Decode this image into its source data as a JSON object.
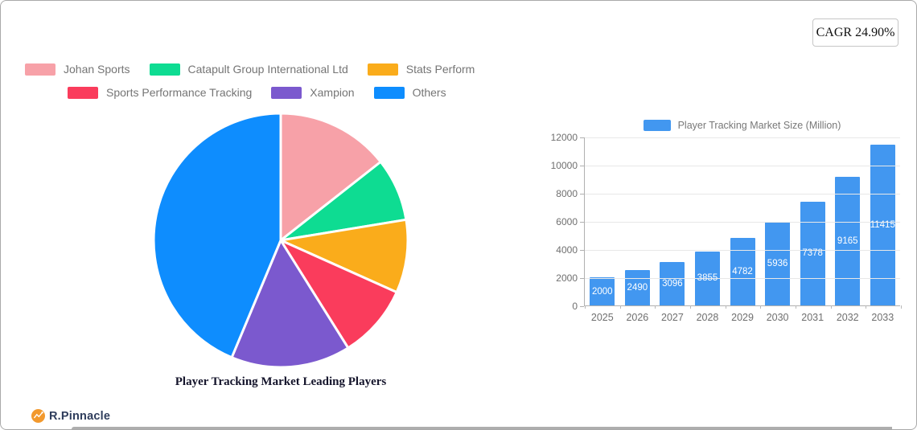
{
  "badge": {
    "label": "CAGR 24.90%"
  },
  "logo": {
    "brand": "R.Pinnacle"
  },
  "chart_data": [
    {
      "type": "pie",
      "title": "Player Tracking Market Leading Players",
      "legend_position": "top",
      "start_angle_deg": 0,
      "gap_color": "#ffffff",
      "series": [
        {
          "name": "Johan Sports",
          "percent": 14.4,
          "color": "#F7A1A8"
        },
        {
          "name": "Catapult Group International Ltd",
          "percent": 8.0,
          "color": "#0EDC92"
        },
        {
          "name": "Stats Perform",
          "percent": 9.3,
          "color": "#FAAC1B"
        },
        {
          "name": "Sports Performance Tracking",
          "percent": 9.4,
          "color": "#FA3C5C"
        },
        {
          "name": "Xampion",
          "percent": 15.2,
          "color": "#7B59CE"
        },
        {
          "name": "Others",
          "percent": 43.7,
          "color": "#0E8DFE"
        }
      ]
    },
    {
      "type": "bar",
      "legend": "Player Tracking Market Size (Million)",
      "categories": [
        "2025",
        "2026",
        "2027",
        "2028",
        "2029",
        "2030",
        "2031",
        "2032",
        "2033"
      ],
      "values": [
        2000,
        2490,
        3096,
        3855,
        4782,
        5936,
        7378,
        9165,
        11415
      ],
      "bar_color": "#4297F0",
      "value_label_color": "#ffffff",
      "ylim": [
        0,
        12000
      ],
      "yticks": [
        0,
        2000,
        4000,
        6000,
        8000,
        10000,
        12000
      ],
      "grid": true,
      "xlabel": "",
      "ylabel": ""
    }
  ]
}
